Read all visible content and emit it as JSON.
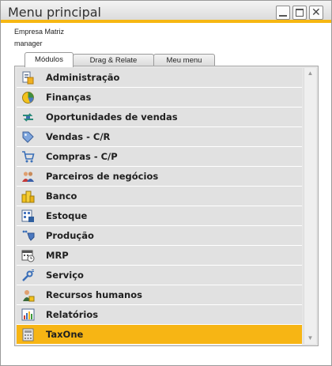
{
  "window": {
    "title": "Menu principal",
    "accent_color": "#f6b712"
  },
  "header": {
    "company": "Empresa Matriz",
    "user": "manager"
  },
  "tabs": [
    {
      "label": "Módulos",
      "active": true
    },
    {
      "label": "Drag & Relate",
      "active": false
    },
    {
      "label": "Meu menu",
      "active": false
    }
  ],
  "modules": [
    {
      "label": "Administração",
      "icon": "administration-icon"
    },
    {
      "label": "Finanças",
      "icon": "finance-pie-icon"
    },
    {
      "label": "Oportunidades de vendas",
      "icon": "sales-opportunities-icon"
    },
    {
      "label": "Vendas - C/R",
      "icon": "sales-tag-icon"
    },
    {
      "label": "Compras - C/P",
      "icon": "shopping-cart-icon"
    },
    {
      "label": "Parceiros de negócios",
      "icon": "business-partners-icon"
    },
    {
      "label": "Banco",
      "icon": "bank-icon"
    },
    {
      "label": "Estoque",
      "icon": "inventory-icon"
    },
    {
      "label": "Produção",
      "icon": "production-icon"
    },
    {
      "label": "MRP",
      "icon": "mrp-icon"
    },
    {
      "label": "Serviço",
      "icon": "service-wrench-icon"
    },
    {
      "label": "Recursos humanos",
      "icon": "human-resources-icon"
    },
    {
      "label": "Relatórios",
      "icon": "reports-icon"
    },
    {
      "label": "TaxOne",
      "icon": "taxone-icon",
      "selected": true
    }
  ]
}
